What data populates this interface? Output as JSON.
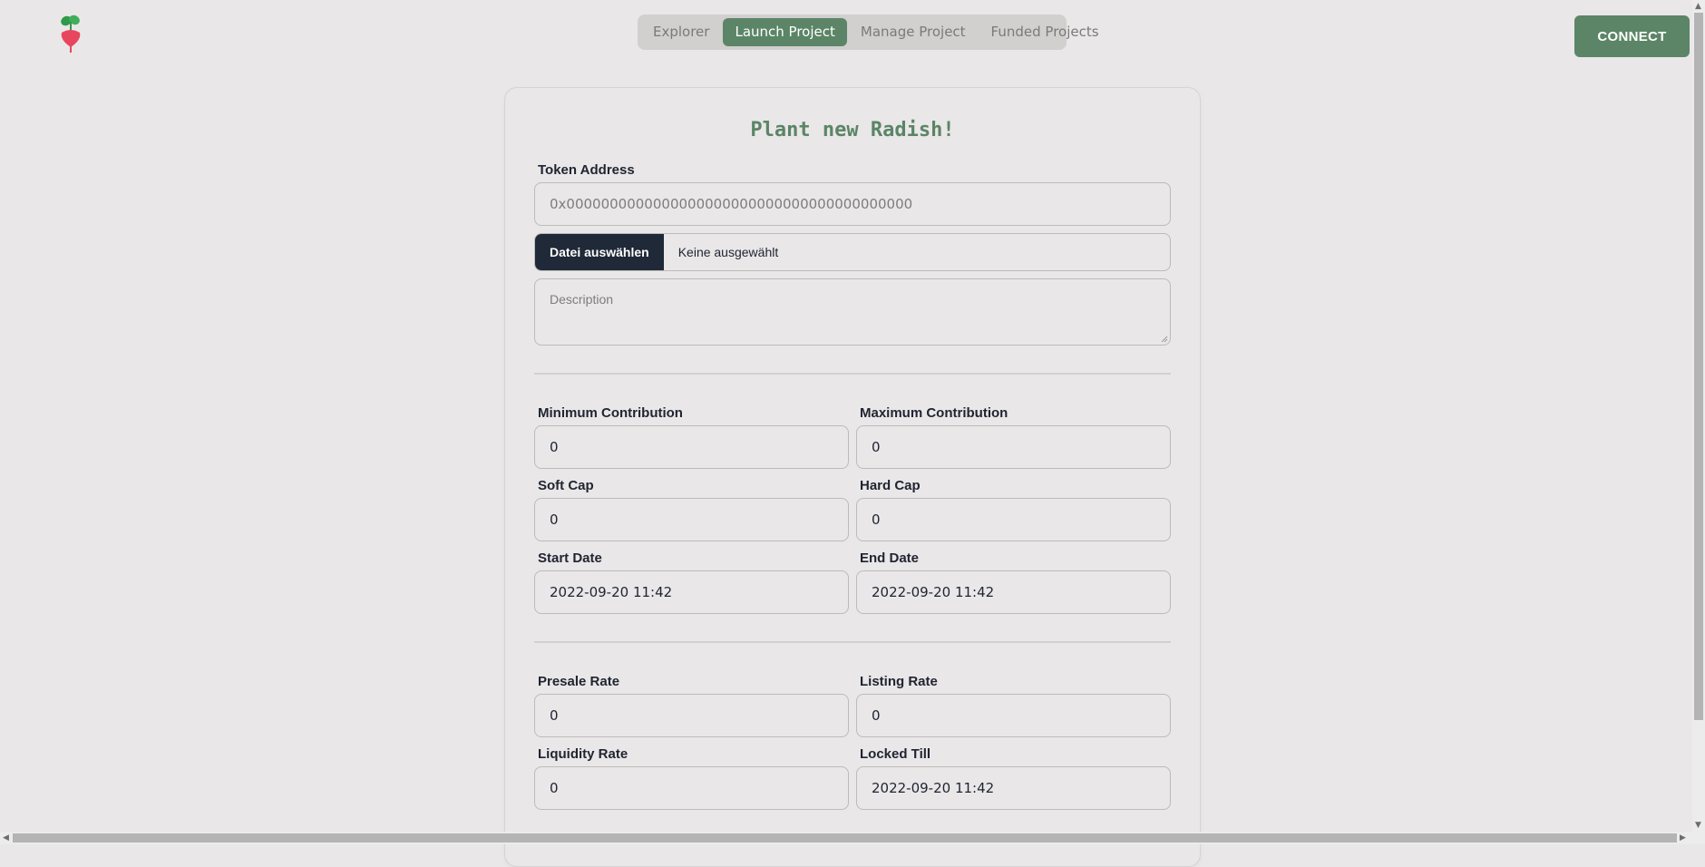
{
  "header": {
    "logo_icon": "radish-icon",
    "nav": [
      {
        "label": "Explorer",
        "active": false
      },
      {
        "label": "Launch Project",
        "active": true
      },
      {
        "label": "Manage Project",
        "active": false
      },
      {
        "label": "Funded Projects",
        "active": false
      }
    ],
    "connect_label": "CONNECT"
  },
  "form": {
    "title": "Plant new Radish!",
    "token_address": {
      "label": "Token Address",
      "placeholder": "0x0000000000000000000000000000000000000000"
    },
    "file": {
      "button_label": "Datei auswählen",
      "status": "Keine ausgewählt"
    },
    "description": {
      "placeholder": "Description"
    },
    "min_contribution": {
      "label": "Minimum Contribution",
      "value": "0"
    },
    "max_contribution": {
      "label": "Maximum Contribution",
      "value": "0"
    },
    "soft_cap": {
      "label": "Soft Cap",
      "value": "0"
    },
    "hard_cap": {
      "label": "Hard Cap",
      "value": "0"
    },
    "start_date": {
      "label": "Start Date",
      "value": "2022-09-20 11:42"
    },
    "end_date": {
      "label": "End Date",
      "value": "2022-09-20 11:42"
    },
    "presale_rate": {
      "label": "Presale Rate",
      "value": "0"
    },
    "listing_rate": {
      "label": "Listing Rate",
      "value": "0"
    },
    "liquidity_rate": {
      "label": "Liquidity Rate",
      "value": "0"
    },
    "locked_till": {
      "label": "Locked Till",
      "value": "2022-09-20 11:42"
    }
  },
  "colors": {
    "accent": "#5b8566",
    "background": "#e9e7e8",
    "file_button": "#1f2937"
  }
}
